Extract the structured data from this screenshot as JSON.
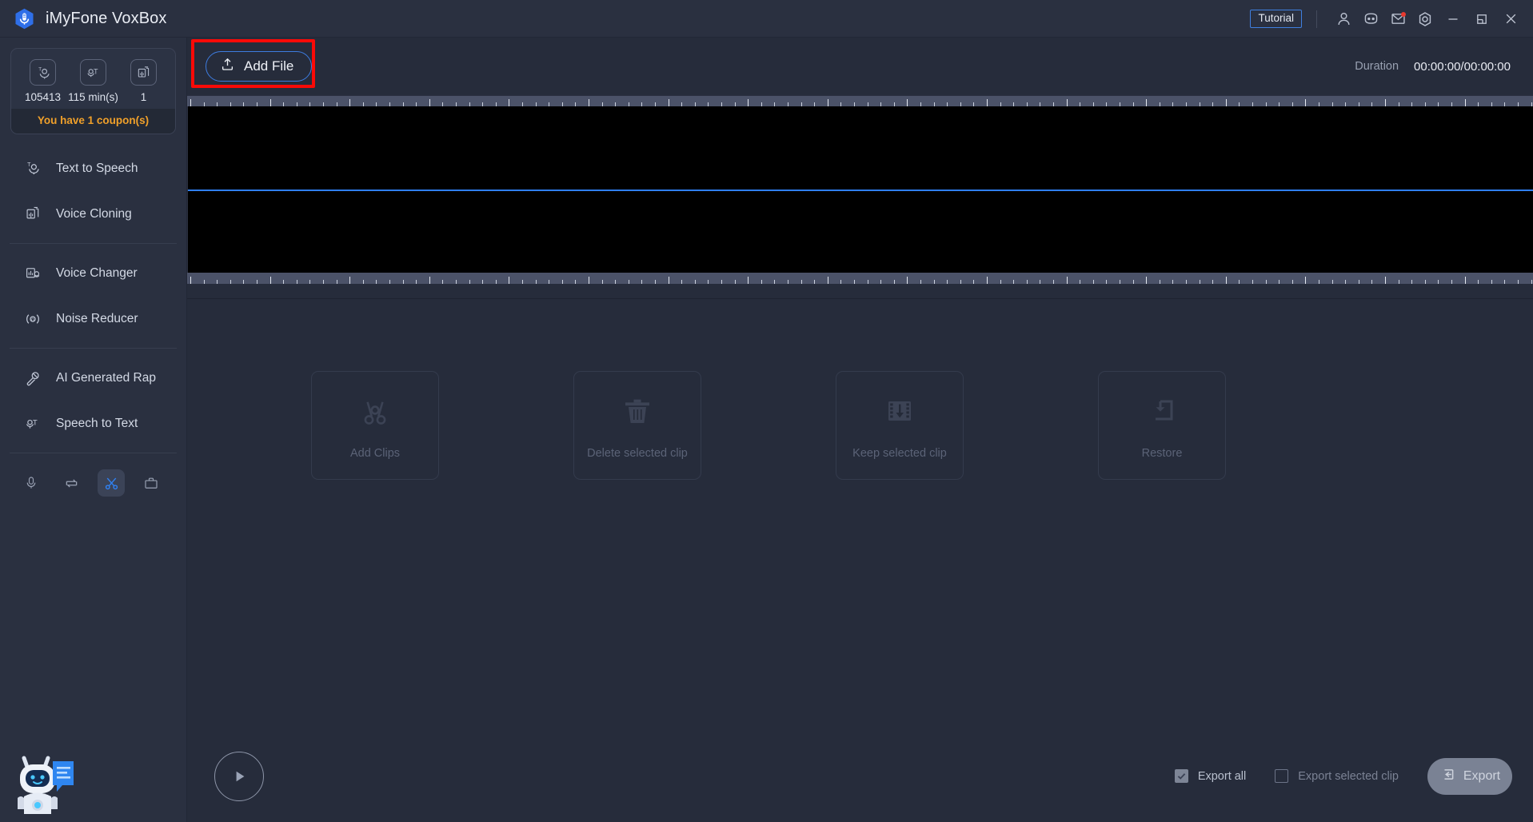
{
  "window": {
    "app_title": "iMyFone VoxBox",
    "logo_icon": "microphone-hexagon-logo",
    "accent_blue": "#2f7ff2",
    "highlight_red": "#fa0a07",
    "coupon_orange": "#f0a02a"
  },
  "titlebar": {
    "tutorial_label": "Tutorial",
    "icons": [
      {
        "name": "account-icon",
        "glyph": "user"
      },
      {
        "name": "discord-icon",
        "glyph": "discord"
      },
      {
        "name": "mail-icon",
        "glyph": "mail",
        "badge": true
      },
      {
        "name": "settings-icon",
        "glyph": "gear"
      }
    ],
    "window_controls": [
      {
        "name": "minimize-button",
        "glyph": "minimize"
      },
      {
        "name": "maximize-button",
        "glyph": "maximize"
      },
      {
        "name": "close-button",
        "glyph": "close"
      }
    ]
  },
  "sidebar": {
    "credits": [
      {
        "icon": "text-to-speech-icon",
        "value": "105413"
      },
      {
        "icon": "speech-to-text-icon",
        "value": "115 min(s)"
      },
      {
        "icon": "voice-cloning-icon",
        "value": "1"
      }
    ],
    "coupon_text": "You have 1 coupon(s)",
    "items": [
      {
        "label": "Text to Speech",
        "icon": "text-to-speech-icon"
      },
      {
        "label": "Voice Cloning",
        "icon": "voice-cloning-icon"
      },
      {
        "label": "Voice Changer",
        "icon": "voice-changer-icon"
      },
      {
        "label": "Noise Reducer",
        "icon": "noise-reducer-icon"
      },
      {
        "label": "AI Generated Rap",
        "icon": "ai-rap-icon"
      },
      {
        "label": "Speech to Text",
        "icon": "speech-to-text-icon"
      }
    ],
    "tools": [
      {
        "name": "recorder-icon",
        "active": false
      },
      {
        "name": "converter-icon",
        "active": false
      },
      {
        "name": "cutter-scissors-icon",
        "active": true
      },
      {
        "name": "toolbox-icon",
        "active": false
      }
    ],
    "mascot_icon": "chatbot-assistant-icon"
  },
  "toolbar": {
    "add_file_label": "Add File",
    "add_file_icon": "upload-icon",
    "duration_label": "Duration",
    "duration_value": "00:00:00/00:00:00"
  },
  "editor": {
    "waveform_empty": true,
    "clip_actions": [
      {
        "label": "Add Clips",
        "icon": "scissors-icon"
      },
      {
        "label": "Delete selected clip",
        "icon": "trash-icon"
      },
      {
        "label": "Keep selected clip",
        "icon": "film-download-icon"
      },
      {
        "label": "Restore",
        "icon": "restore-icon"
      }
    ]
  },
  "bottombar": {
    "play_icon": "play-icon",
    "export_all_label": "Export all",
    "export_all_checked": true,
    "export_selected_label": "Export selected clip",
    "export_selected_checked": false,
    "export_button_label": "Export",
    "export_button_icon": "export-icon"
  }
}
